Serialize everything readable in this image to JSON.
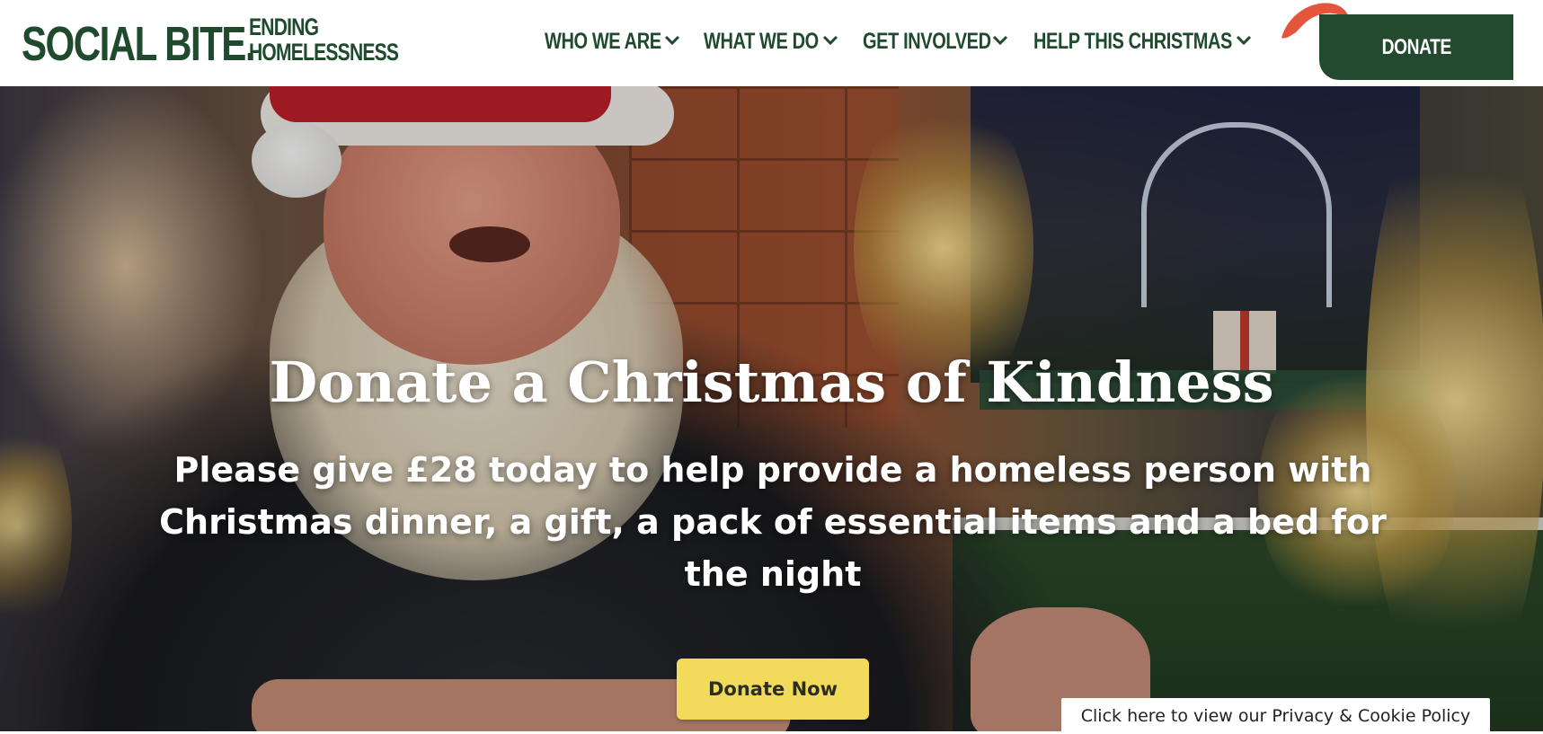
{
  "header": {
    "logo_main": "SOCIAL BITE.",
    "logo_tag_line1": "ENDING",
    "logo_tag_line2": "HOMELESSNESS",
    "nav": [
      {
        "label": "WHO WE ARE",
        "icon": "chevron-down-icon"
      },
      {
        "label": "WHAT WE DO",
        "icon": "chevron-down-icon"
      },
      {
        "label": "GET INVOLVED",
        "icon": "chevron-down-icon"
      },
      {
        "label": "HELP THIS CHRISTMAS",
        "icon": "chevron-down-icon"
      }
    ],
    "donate_label": "DONATE"
  },
  "hero": {
    "title": "Donate a Christmas of Kindness",
    "subtitle": "Please give £28 today to help provide a homeless person with Christmas dinner, a gift, a pack of essential items and a bed for the night",
    "cta_label": "Donate Now"
  },
  "privacy_banner": {
    "label": "Click here to view our Privacy & Cookie Policy"
  },
  "colors": {
    "brand_green": "#234a2e",
    "cta_yellow": "#f2db5a",
    "hat_red": "#e4553c"
  }
}
